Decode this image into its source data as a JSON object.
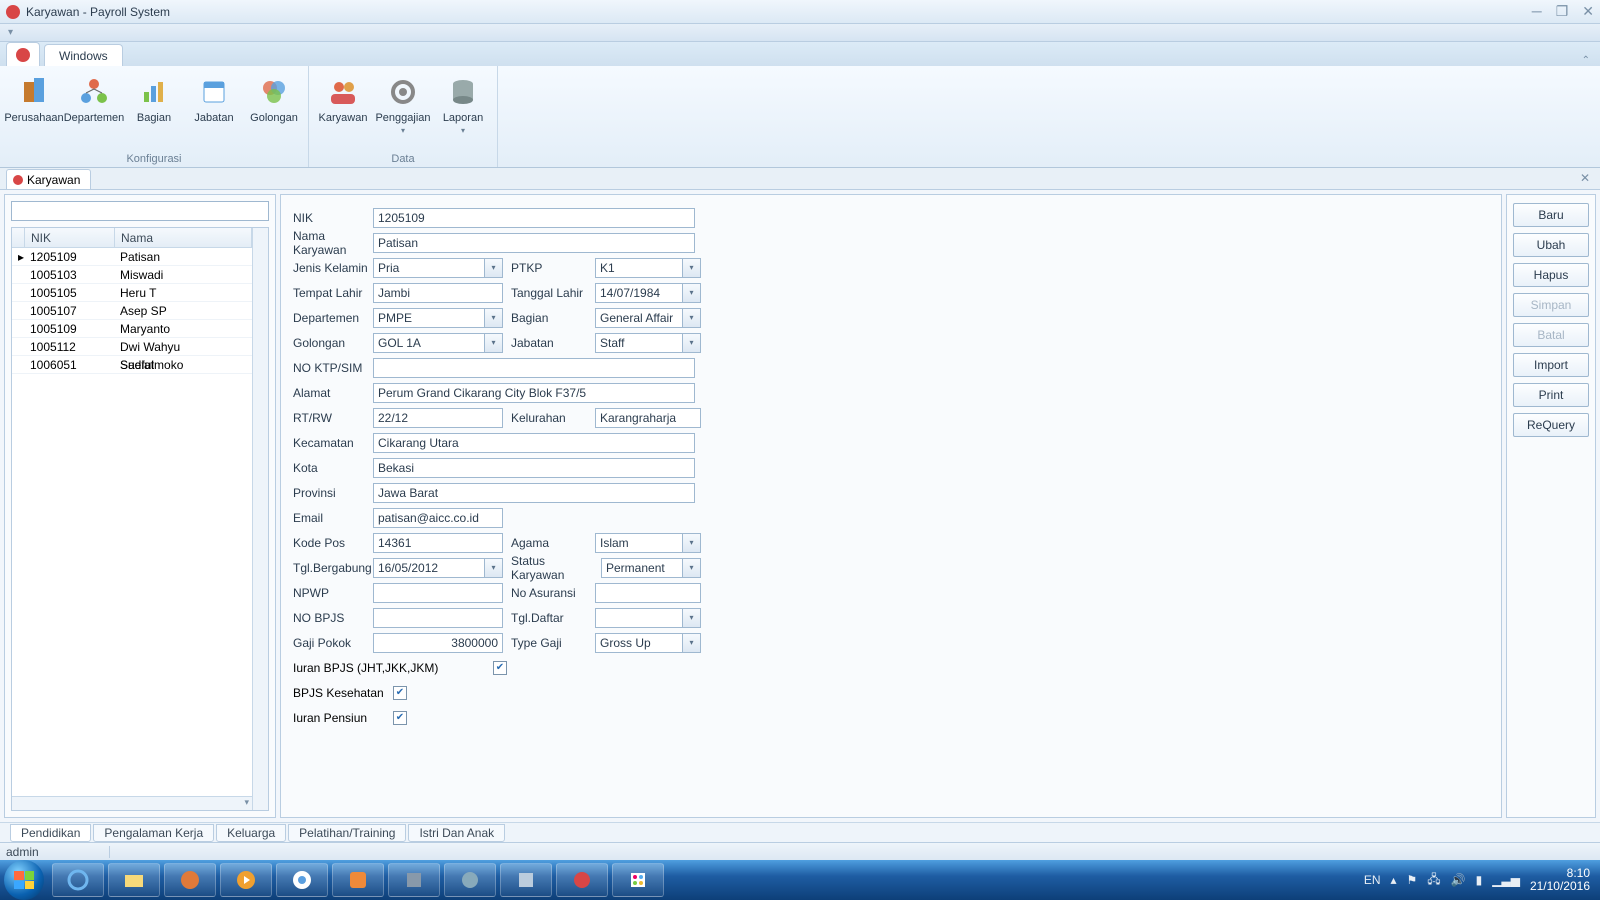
{
  "window": {
    "title": "Karyawan - Payroll System"
  },
  "ribbon": {
    "tab": "Windows",
    "groups": {
      "konfigurasi": {
        "label": "Konfigurasi",
        "items": [
          "Perusahaan",
          "Departemen",
          "Bagian",
          "Jabatan",
          "Golongan"
        ]
      },
      "data": {
        "label": "Data",
        "items": [
          "Karyawan",
          "Penggajian",
          "Laporan"
        ]
      }
    }
  },
  "docTab": "Karyawan",
  "grid": {
    "cols": [
      "NIK",
      "Nama"
    ],
    "rows": [
      {
        "nik": "1205109",
        "nama": "Patisan",
        "selected": true
      },
      {
        "nik": "1005103",
        "nama": "Miswadi"
      },
      {
        "nik": "1005105",
        "nama": "Heru T"
      },
      {
        "nik": "1005107",
        "nama": "Asep SP"
      },
      {
        "nik": "1005109",
        "nama": "Maryanto"
      },
      {
        "nik": "1005112",
        "nama": "Dwi Wahyu Sudiatmoko"
      },
      {
        "nik": "1006051",
        "nama": "Saeful"
      }
    ]
  },
  "form": {
    "nik_label": "NIK",
    "nik": "1205109",
    "nama_label": "Nama Karyawan",
    "nama": "Patisan",
    "jk_label": "Jenis Kelamin",
    "jk": "Pria",
    "ptkp_label": "PTKP",
    "ptkp": "K1",
    "tlahir_label": "Tempat Lahir",
    "tlahir": "Jambi",
    "tgllahir_label": "Tanggal Lahir",
    "tgllahir": "14/07/1984",
    "dept_label": "Departemen",
    "dept": "PMPE",
    "bagian_label": "Bagian",
    "bagian": "General Affair",
    "gol_label": "Golongan",
    "gol": "GOL 1A",
    "jabatan_label": "Jabatan",
    "jabatan": "Staff",
    "ktp_label": "NO KTP/SIM",
    "ktp": "",
    "alamat_label": "Alamat",
    "alamat": "Perum Grand Cikarang City Blok F37/5",
    "rtrw_label": "RT/RW",
    "rtrw": "22/12",
    "kel_label": "Kelurahan",
    "kel": "Karangraharja",
    "kec_label": "Kecamatan",
    "kec": "Cikarang Utara",
    "kota_label": "Kota",
    "kota": "Bekasi",
    "prov_label": "Provinsi",
    "prov": "Jawa Barat",
    "email_label": "Email",
    "email": "patisan@aicc.co.id",
    "kodepos_label": "Kode Pos",
    "kodepos": "14361",
    "agama_label": "Agama",
    "agama": "Islam",
    "tgljoin_label": "Tgl.Bergabung",
    "tgljoin": "16/05/2012",
    "status_label": "Status Karyawan",
    "status": "Permanent",
    "npwp_label": "NPWP",
    "npwp": "",
    "asuransi_label": "No Asuransi",
    "asuransi": "",
    "bpjs_label": "NO BPJS",
    "bpjs": "",
    "tgldaftar_label": "Tgl.Daftar",
    "tgldaftar": "",
    "gaji_label": "Gaji Pokok",
    "gaji": "3800000",
    "tipegaji_label": "Type Gaji",
    "tipegaji": "Gross Up",
    "iuran_bpjs_label": "Iuran BPJS (JHT,JKK,JKM)",
    "bpjs_kes_label": "BPJS Kesehatan",
    "iuran_pensiun_label": "Iuran Pensiun"
  },
  "actions": {
    "baru": "Baru",
    "ubah": "Ubah",
    "hapus": "Hapus",
    "simpan": "Simpan",
    "batal": "Batal",
    "import": "Import",
    "print": "Print",
    "requery": "ReQuery"
  },
  "bottomTabs": [
    "Pendidikan",
    "Pengalaman Kerja",
    "Keluarga",
    "Pelatihan/Training",
    "Istri Dan Anak"
  ],
  "status": {
    "user": "admin"
  },
  "tray": {
    "lang": "EN",
    "time": "8:10",
    "date": "21/10/2016"
  }
}
